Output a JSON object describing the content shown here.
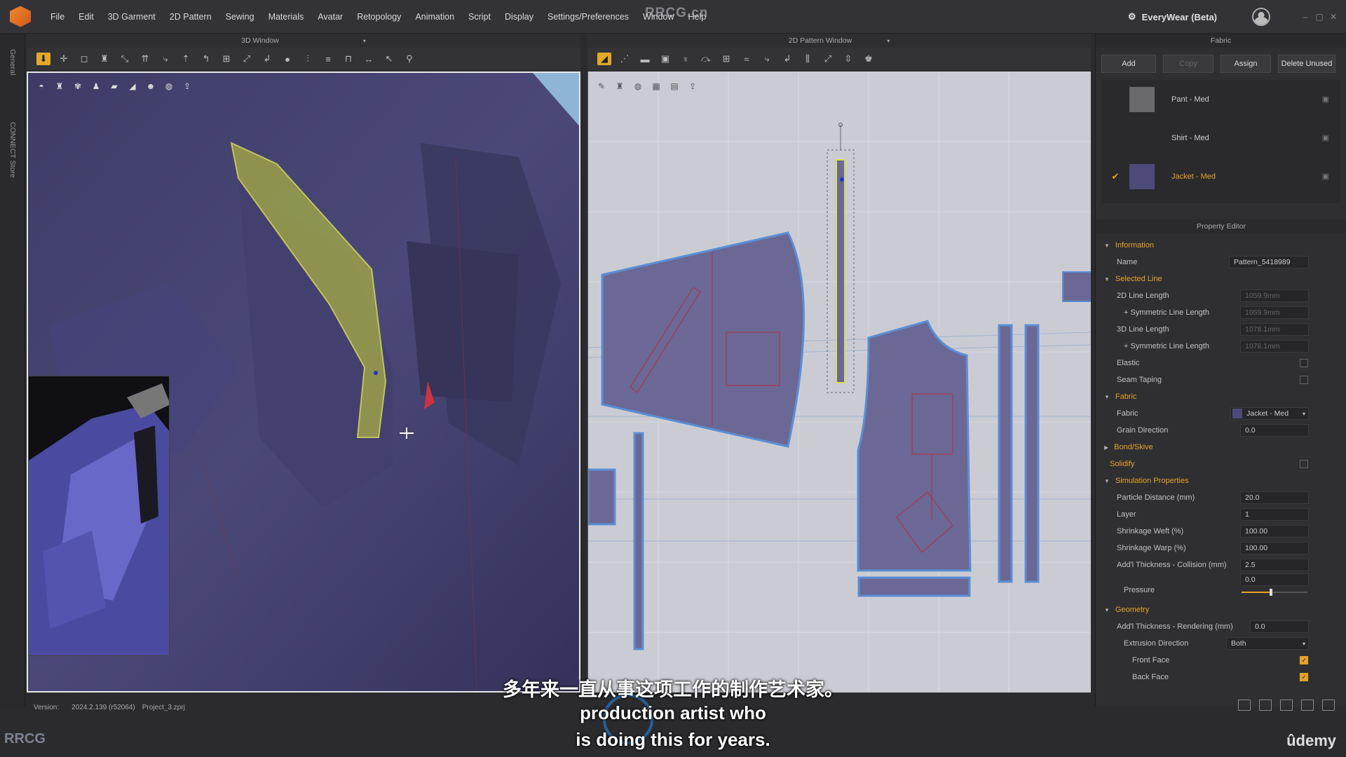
{
  "menu": {
    "items": [
      "File",
      "Edit",
      "3D Garment",
      "2D Pattern",
      "Sewing",
      "Materials",
      "Avatar",
      "Retopology",
      "Animation",
      "Script",
      "Display",
      "Settings/Preferences",
      "Window",
      "Help"
    ],
    "product": "EveryWear (Beta)"
  },
  "watermark": "RRCG.cn",
  "side_strip": {
    "general": "General",
    "connect": "CONNECT Store"
  },
  "windows": {
    "w3d_title": "3D Window",
    "w2d_title": "2D Pattern Window"
  },
  "fabric_panel": {
    "title": "Fabric",
    "buttons": {
      "add": "Add",
      "copy": "Copy",
      "assign": "Assign",
      "delete_unused": "Delete Unused"
    },
    "items": [
      {
        "name": "Pant - Med",
        "color": "#6a6a6c",
        "selected": false
      },
      {
        "name": "Shirt - Med",
        "color": "#2a2a2c",
        "selected": false
      },
      {
        "name": "Jacket - Med",
        "color": "#4d4a7a",
        "selected": true
      }
    ]
  },
  "property_editor": {
    "title": "Property Editor",
    "information": "Information",
    "name_label": "Name",
    "name_value": "Pattern_5418989",
    "selected_line": "Selected Line",
    "line_2d": "2D Line Length",
    "line_2d_val": "1059.9mm",
    "sym_2d": "+ Symmetric Line Length",
    "sym_2d_val": "1059.9mm",
    "line_3d": "3D Line Length",
    "line_3d_val": "1078.1mm",
    "sym_3d": "+ Symmetric Line Length",
    "sym_3d_val": "1078.1mm",
    "elastic": "Elastic",
    "seam_taping": "Seam Taping",
    "fabric_sec": "Fabric",
    "fabric_label": "Fabric",
    "fabric_value": "Jacket - Med",
    "grain": "Grain Direction",
    "grain_val": "0.0",
    "bond": "Bond/Skive",
    "solidify": "Solidify",
    "sim": "Simulation Properties",
    "particle": "Particle Distance (mm)",
    "particle_val": "20.0",
    "layer": "Layer",
    "layer_val": "1",
    "weft": "Shrinkage Weft (%)",
    "weft_val": "100.00",
    "warp": "Shrinkage Warp (%)",
    "warp_val": "100.00",
    "thick_col": "Add'l Thickness - Collision (mm)",
    "thick_col_val": "2.5",
    "pressure": "Pressure",
    "pressure_val": "0.0",
    "pressure_level": 0.45,
    "geometry": "Geometry",
    "thick_ren": "Add'l Thickness - Rendering (mm)",
    "thick_ren_val": "0.0",
    "extrusion": "Extrusion Direction",
    "extrusion_val": "Both",
    "front": "Front Face",
    "back": "Back Face"
  },
  "status": {
    "version_label": "Version:",
    "version": "2024.2.139 (r52064)",
    "project": "Project_3.zprj"
  },
  "subtitles": {
    "zh": "多年来一直从事这项工作的制作艺术家。",
    "en1": "production artist who",
    "en2": "is doing this for years."
  },
  "brand": {
    "udemy": "ûdemy",
    "corner": "RRCG"
  },
  "colors": {
    "accent": "#e6a326",
    "fabric_purple": "#4d4a7a",
    "pattern_fill": "#6b6896",
    "pattern_outline": "#5b8fd6"
  }
}
